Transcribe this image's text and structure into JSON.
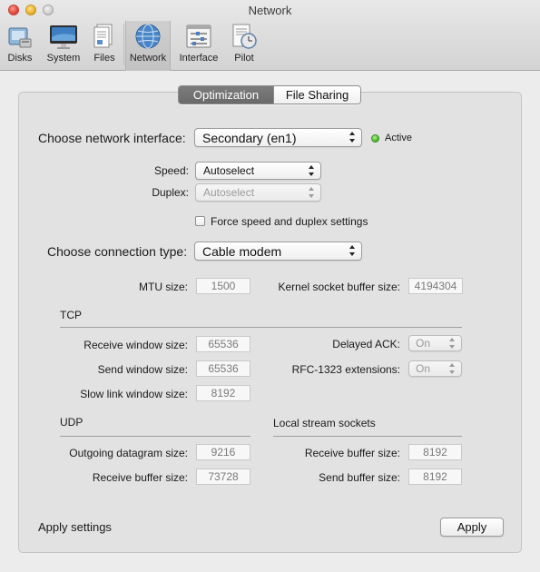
{
  "window": {
    "title": "Network"
  },
  "toolbar": {
    "items": [
      {
        "label": "Disks",
        "icon": "disks-icon"
      },
      {
        "label": "System",
        "icon": "system-icon"
      },
      {
        "label": "Files",
        "icon": "files-icon"
      },
      {
        "label": "Network",
        "icon": "network-icon",
        "selected": true
      },
      {
        "label": "Interface",
        "icon": "interface-icon"
      },
      {
        "label": "Pilot",
        "icon": "pilot-icon"
      }
    ]
  },
  "tabs": [
    {
      "label": "Optimization",
      "selected": true
    },
    {
      "label": "File Sharing",
      "selected": false
    }
  ],
  "network_interface": {
    "label": "Choose network interface:",
    "value": "Secondary (en1)",
    "status": "Active",
    "status_color": "#45b62a"
  },
  "speed": {
    "label": "Speed:",
    "value": "Autoselect"
  },
  "duplex": {
    "label": "Duplex:",
    "value": "Autoselect"
  },
  "force_checkbox": {
    "label": "Force speed and duplex settings",
    "checked": false
  },
  "connection_type": {
    "label": "Choose connection type:",
    "value": "Cable modem"
  },
  "mtu": {
    "label": "MTU size:",
    "value": "1500"
  },
  "kernel_buffer": {
    "label": "Kernel socket buffer size:",
    "value": "4194304"
  },
  "tcp": {
    "heading": "TCP",
    "receive_window": {
      "label": "Receive window size:",
      "value": "65536"
    },
    "send_window": {
      "label": "Send window size:",
      "value": "65536"
    },
    "slow_link_window": {
      "label": "Slow link window size:",
      "value": "8192"
    },
    "delayed_ack": {
      "label": "Delayed ACK:",
      "value": "On"
    },
    "rfc1323": {
      "label": "RFC-1323 extensions:",
      "value": "On"
    }
  },
  "udp": {
    "heading": "UDP",
    "outgoing_datagram": {
      "label": "Outgoing datagram size:",
      "value": "9216"
    },
    "receive_buffer": {
      "label": "Receive buffer size:",
      "value": "73728"
    }
  },
  "local_stream": {
    "heading": "Local stream sockets",
    "receive_buffer": {
      "label": "Receive buffer size:",
      "value": "8192"
    },
    "send_buffer": {
      "label": "Send buffer size:",
      "value": "8192"
    }
  },
  "footer": {
    "apply_label": "Apply settings",
    "apply_button": "Apply"
  }
}
